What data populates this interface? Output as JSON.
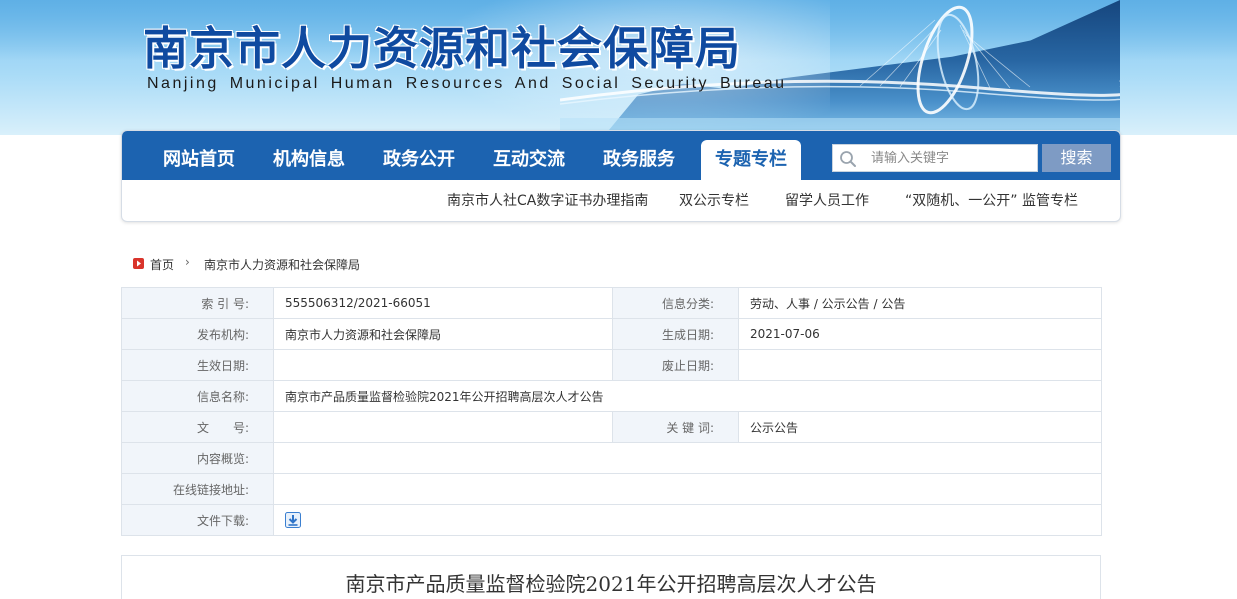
{
  "header": {
    "title": "南京市人力资源和社会保障局",
    "subtitle": "Nanjing Municipal Human Resources And Social Security Bureau"
  },
  "nav": {
    "items": [
      "网站首页",
      "机构信息",
      "政务公开",
      "互动交流",
      "政务服务",
      "专题专栏"
    ],
    "active_index": 5,
    "search_placeholder": "请输入关键字",
    "search_button": "搜索",
    "sub_items": [
      "南京市人社CA数字证书办理指南",
      "双公示专栏",
      "留学人员工作",
      "“双随机、一公开” 监管专栏"
    ]
  },
  "breadcrumb": {
    "home": "首页",
    "separator": "›",
    "current": "南京市人力资源和社会保障局"
  },
  "meta": {
    "index_no_label": "索 引 号:",
    "index_no": "555506312/2021-66051",
    "category_label": "信息分类:",
    "category": "劳动、人事 / 公示公告 / 公告",
    "publisher_label": "发布机构:",
    "publisher": "南京市人力资源和社会保障局",
    "created_label": "生成日期:",
    "created": "2021-07-06",
    "effective_label": "生效日期:",
    "effective": "",
    "abolished_label": "废止日期:",
    "abolished": "",
    "name_label": "信息名称:",
    "name": "南京市产品质量监督检验院2021年公开招聘高层次人才公告",
    "doc_no_label": "文　　号:",
    "doc_no": "",
    "keywords_label": "关 键 词:",
    "keywords": "公示公告",
    "summary_label": "内容概览:",
    "summary": "",
    "link_label": "在线链接地址:",
    "link": "",
    "download_label": "文件下载:"
  },
  "article": {
    "title": "南京市产品质量监督检验院2021年公开招聘高层次人才公告"
  },
  "colors": {
    "nav_blue": "#1c63b0",
    "title_blue": "#0f4aa0",
    "label_bg": "#f1f5fa",
    "search_button": "#7e9bc4"
  }
}
